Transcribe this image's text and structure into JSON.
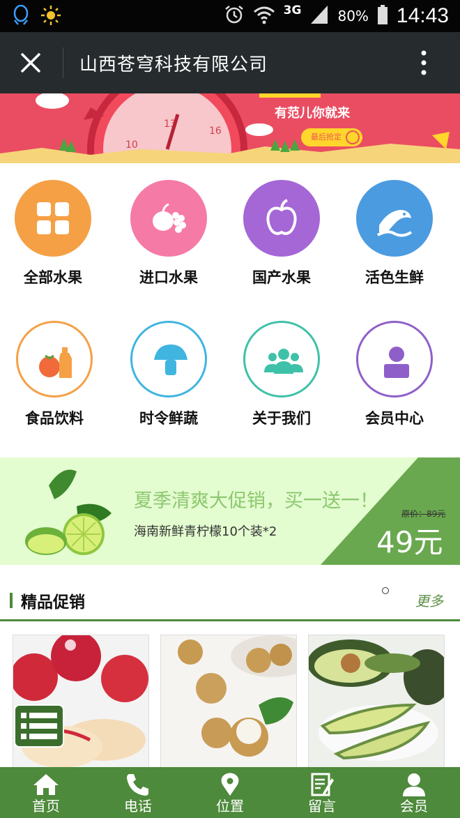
{
  "status_bar": {
    "network": "3G",
    "battery_percent": "80%",
    "time": "14:43",
    "icons": [
      "qq-icon",
      "brightness-icon",
      "alarm-icon",
      "wifi-icon",
      "signal-icon",
      "battery-icon"
    ]
  },
  "title_bar": {
    "title": "山西苍穹科技有限公司",
    "close_icon": "close-icon",
    "more_icon": "more-vertical-icon"
  },
  "banner": {
    "slogan": "有范儿你就来",
    "cta_label": "最后抢定",
    "colors": {
      "background": "#e8435b",
      "cta": "#ffd62b"
    }
  },
  "categories": [
    {
      "label": "全部水果",
      "icon": "grid-icon",
      "color": "#f5a045",
      "style": "filled"
    },
    {
      "label": "进口水果",
      "icon": "fruit-basket-icon",
      "color": "#f57aa6",
      "style": "filled"
    },
    {
      "label": "国产水果",
      "icon": "apple-icon",
      "color": "#a566d6",
      "style": "filled"
    },
    {
      "label": "活色生鲜",
      "icon": "fish-icon",
      "color": "#4b9be0",
      "style": "filled"
    },
    {
      "label": "食品饮料",
      "icon": "food-drink-icon",
      "color": "#f5a045",
      "style": "outline"
    },
    {
      "label": "时令鲜蔬",
      "icon": "mushroom-icon",
      "color": "#3fb5e0",
      "style": "outline"
    },
    {
      "label": "关于我们",
      "icon": "group-icon",
      "color": "#3ec1a8",
      "style": "outline"
    },
    {
      "label": "会员中心",
      "icon": "user-icon",
      "color": "#8f5fc9",
      "style": "outline"
    }
  ],
  "promo": {
    "headline": "夏季清爽大促销，买一送一！",
    "subtitle": "海南新鲜青柠檬10个装*2",
    "original_price": "原价：89元",
    "price": "49元",
    "colors": {
      "background": "#e3fcd0",
      "accent": "#6aa84f"
    }
  },
  "section": {
    "title": "精品促销",
    "more_label": "更多"
  },
  "products": [
    {
      "image": "red-apples-image"
    },
    {
      "image": "longan-image"
    },
    {
      "image": "avocado-image"
    }
  ],
  "bottom_nav": [
    {
      "label": "首页",
      "icon": "home-icon"
    },
    {
      "label": "电话",
      "icon": "phone-icon"
    },
    {
      "label": "位置",
      "icon": "location-icon"
    },
    {
      "label": "留言",
      "icon": "message-icon"
    },
    {
      "label": "会员",
      "icon": "member-icon"
    }
  ],
  "theme": {
    "nav_green": "#4d8a3b",
    "title_bar": "#262b2e"
  }
}
